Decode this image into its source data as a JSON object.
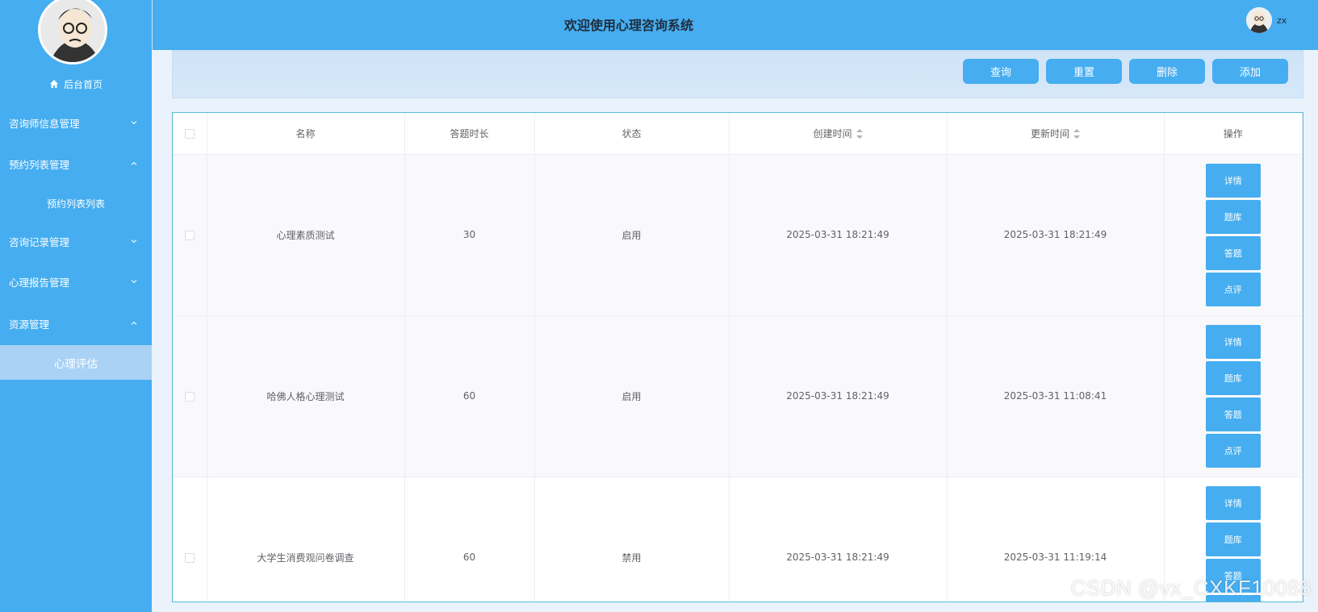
{
  "sidebar": {
    "home_label": "后台首页",
    "menus": [
      {
        "label": "咨询师信息管理",
        "expanded": false
      },
      {
        "label": "预约列表管理",
        "expanded": true
      },
      {
        "label": "咨询记录管理",
        "expanded": false
      },
      {
        "label": "心理报告管理",
        "expanded": false
      },
      {
        "label": "资源管理",
        "expanded": true
      }
    ],
    "submenus": {
      "appointment": "预约列表列表",
      "resources": "心理评估"
    }
  },
  "header": {
    "title": "欢迎使用心理咨询系统",
    "username": "zx"
  },
  "toolbar": {
    "query": "查询",
    "reset": "重置",
    "delete": "删除",
    "add": "添加"
  },
  "table": {
    "columns": [
      "名称",
      "答题时长",
      "状态",
      "创建时间",
      "更新时间",
      "操作"
    ],
    "rows": [
      {
        "name": "心理素质测试",
        "duration": "30",
        "status": "启用",
        "created": "2025-03-31 18:21:49",
        "updated": "2025-03-31 18:21:49"
      },
      {
        "name": "哈佛人格心理测试",
        "duration": "60",
        "status": "启用",
        "created": "2025-03-31 18:21:49",
        "updated": "2025-03-31 11:08:41"
      },
      {
        "name": "大学生消费观问卷调查",
        "duration": "60",
        "status": "禁用",
        "created": "2025-03-31 18:21:49",
        "updated": "2025-03-31 11:19:14"
      }
    ],
    "actions": [
      "详情",
      "题库",
      "答题",
      "点评"
    ]
  },
  "watermark": "CSDN @vx_CXKF10088",
  "colors": {
    "primary": "#45adf0",
    "active_submenu": "#a9d2f5"
  }
}
